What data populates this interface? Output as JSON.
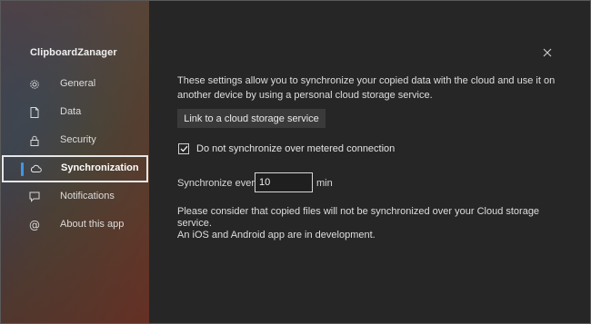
{
  "app": {
    "title": "ClipboardZanager"
  },
  "sidebar": {
    "items": [
      {
        "label": "General",
        "icon": "gear-icon",
        "active": false
      },
      {
        "label": "Data",
        "icon": "document-icon",
        "active": false
      },
      {
        "label": "Security",
        "icon": "lock-icon",
        "active": false
      },
      {
        "label": "Synchronization",
        "icon": "cloud-icon",
        "active": true
      },
      {
        "label": "Notifications",
        "icon": "message-icon",
        "active": false
      },
      {
        "label": "About this app",
        "icon": "at-icon",
        "active": false
      }
    ]
  },
  "content": {
    "description": "These settings allow you to synchronize your copied data with the cloud and use it on another device by using a personal cloud storage service.",
    "link_button": "Link to a cloud storage service",
    "metered_checkbox": {
      "label": "Do not synchronize over metered connection",
      "checked": true
    },
    "sync_interval": {
      "label": "Synchronize every :",
      "value": "10",
      "unit": "min"
    },
    "note_line1": "Please consider that copied files will not be synchronized over your Cloud storage service.",
    "note_line2": "An iOS and Android app are in development."
  },
  "colors": {
    "background": "#262626",
    "accent": "#3f96e6",
    "button": "#3a3a3a"
  }
}
